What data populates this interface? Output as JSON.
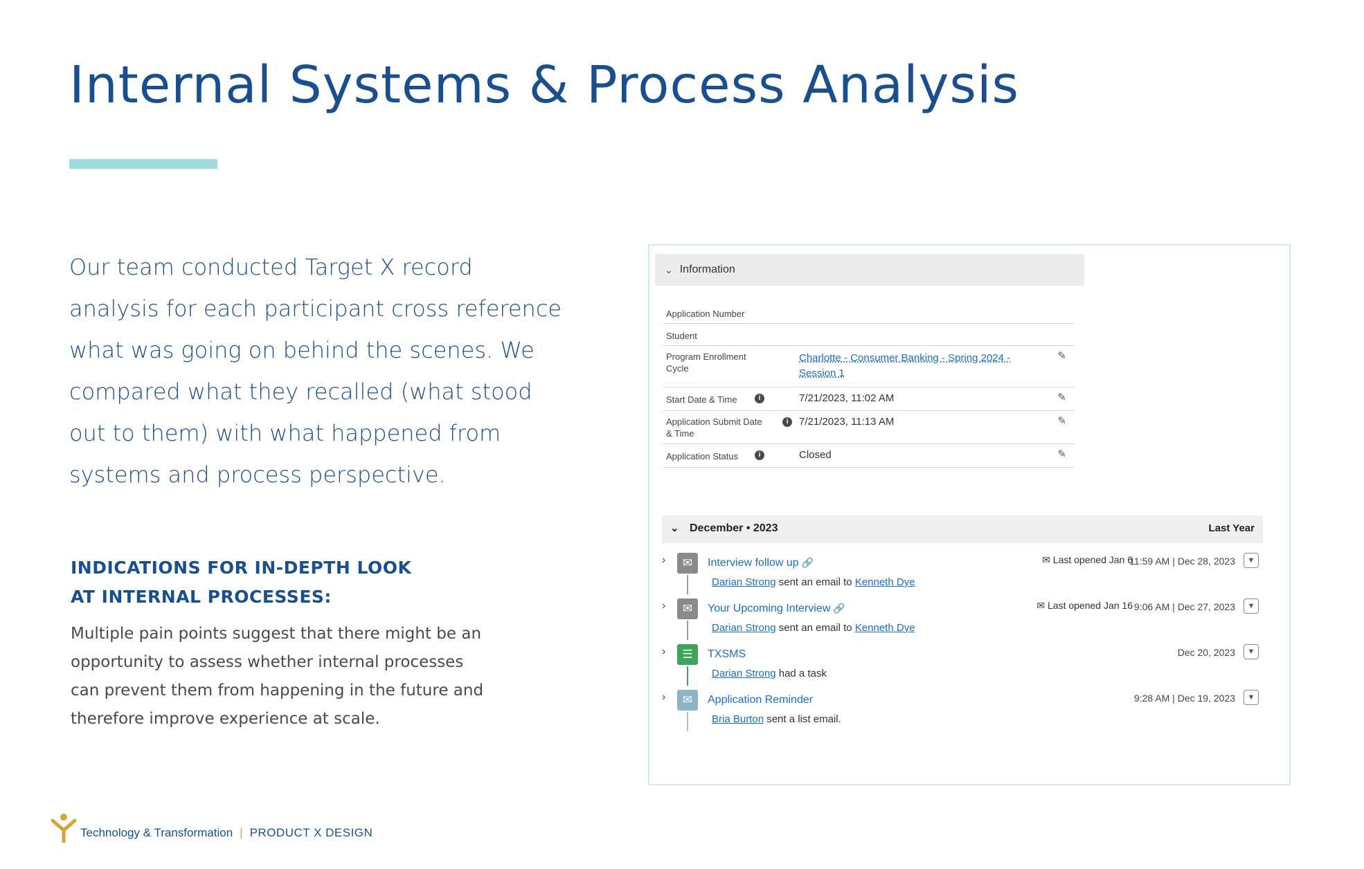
{
  "slide": {
    "title": "Internal Systems & Process Analysis",
    "intro_lines": [
      "Our team conducted Target X record",
      "analysis for each participant cross reference",
      "what was going on behind the scenes. We",
      "compared what they recalled (what stood",
      "out to them) with what happened from",
      "systems and process perspective."
    ],
    "indications_heading_lines": [
      "INDICATIONS FOR IN-DEPTH LOOK",
      "AT INTERNAL PROCESSES:"
    ],
    "indications_body_lines": [
      "Multiple pain points suggest that there might be an",
      "opportunity to assess whether internal processes",
      "can prevent them from happening in the future and",
      "therefore improve experience at scale."
    ]
  },
  "record": {
    "section_title": "Information",
    "fields": [
      {
        "label": "Application Number",
        "value": ""
      },
      {
        "label": "Student",
        "value": ""
      },
      {
        "label_lines": [
          "Program Enrollment",
          "Cycle"
        ],
        "value_lines": [
          "Charlotte - Consumer Banking - Spring 2024 -",
          "Session 1"
        ]
      },
      {
        "label": "Start Date & Time",
        "value": "7/21/2023, 11:02 AM"
      },
      {
        "label_lines": [
          "Application Submit Date",
          "& Time"
        ],
        "value": "7/21/2023, 11:13 AM"
      },
      {
        "label": "Application Status",
        "value": "Closed"
      }
    ]
  },
  "timeline": {
    "month": "December • 2023",
    "range": "Last Year",
    "activities": [
      {
        "icon": "email-icon",
        "title": "Interview follow up",
        "person": "Darian Strong",
        "action": "sent an email to",
        "target": "Kenneth Dye",
        "opened": "Last opened Jan 6",
        "date": "11:59 AM | Dec 28, 2023",
        "color": "#8a8a8a"
      },
      {
        "icon": "email-icon",
        "title": "Your Upcoming Interview",
        "person": "Darian Strong",
        "action": "sent an email to",
        "target": "Kenneth Dye",
        "opened": "Last opened Jan 16",
        "date": "9:06 AM | Dec 27, 2023",
        "color": "#8a8a8a"
      },
      {
        "icon": "task-icon",
        "title": "TXSMS",
        "person": "Darian Strong",
        "action": "had a task",
        "target": "",
        "opened": "",
        "date": "Dec 20, 2023",
        "color": "#3ba55c"
      },
      {
        "icon": "list-email-icon",
        "title": "Application Reminder",
        "person": "Bria Burton",
        "action": "sent a list email.",
        "target": "",
        "opened": "",
        "date": "9:28 AM | Dec 19, 2023",
        "color": "#8fb3c6"
      }
    ]
  },
  "footer": {
    "brand": "Technology & Transformation",
    "separator": "|",
    "product": "PRODUCT X DESIGN"
  },
  "colors": {
    "title": "#1a4f8f",
    "accent": "#9ddcdc",
    "link": "#1a6fc0",
    "footer_separator": "#d8a13a"
  }
}
